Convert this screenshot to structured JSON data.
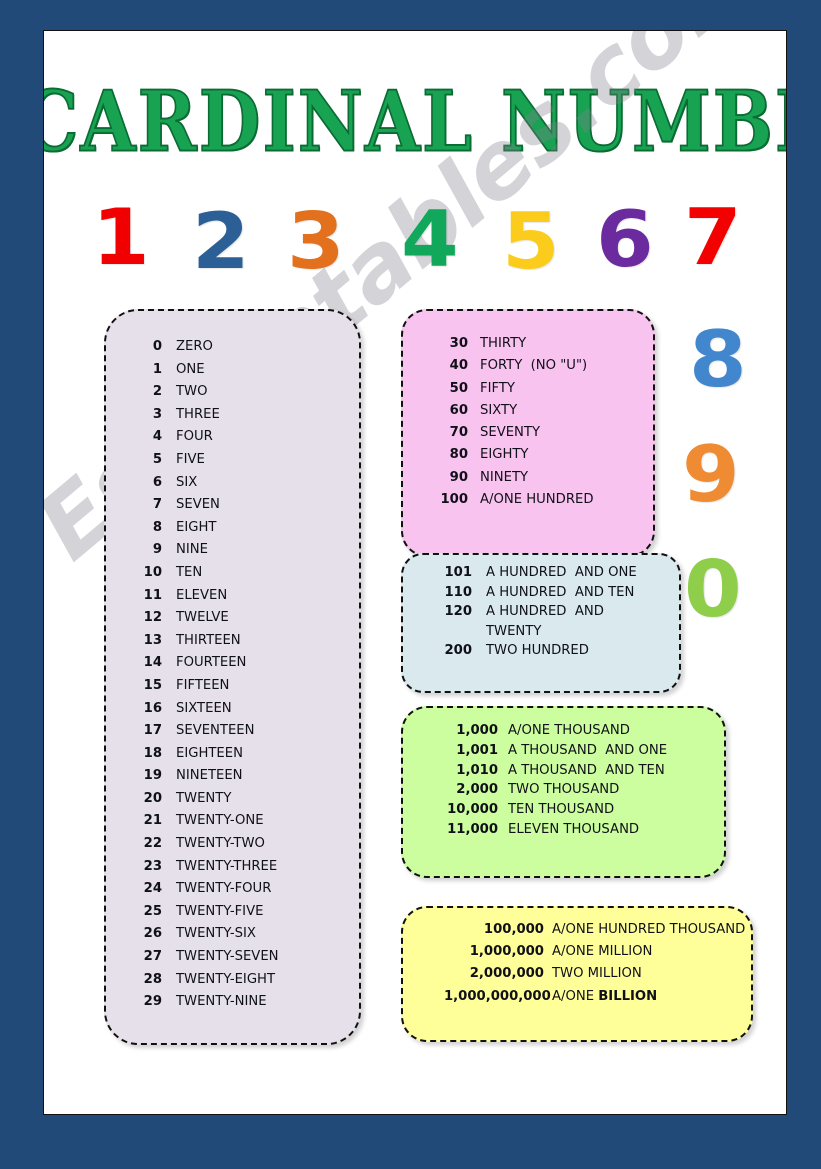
{
  "worksheet": {
    "title": "CARDINAL NUMBERS",
    "watermark": "Eslprintables.com",
    "frame_color": "#214a78",
    "page_color": "#ffffff"
  },
  "digit_banner": {
    "digits": [
      {
        "glyph": "1",
        "color": "#f00000"
      },
      {
        "glyph": "2",
        "color": "#2c5f96"
      },
      {
        "glyph": "3",
        "color": "#e2701d"
      },
      {
        "glyph": "4",
        "color": "#12a85c"
      },
      {
        "glyph": "5",
        "color": "#fbcc1b"
      },
      {
        "glyph": "6",
        "color": "#6b2a9e"
      },
      {
        "glyph": "7",
        "color": "#f30000"
      },
      {
        "glyph": "8",
        "color": "#4287ce"
      },
      {
        "glyph": "9",
        "color": "#ef8b32"
      },
      {
        "glyph": "0",
        "color": "#8ece4a"
      }
    ]
  },
  "panels": {
    "ones_and_teens": {
      "fill": "#e5e0ea",
      "rows": [
        {
          "num": "0",
          "word": "ZERO"
        },
        {
          "num": "1",
          "word": "ONE"
        },
        {
          "num": "2",
          "word": "TWO"
        },
        {
          "num": "3",
          "word": "THREE"
        },
        {
          "num": "4",
          "word": "FOUR"
        },
        {
          "num": "5",
          "word": "FIVE"
        },
        {
          "num": "6",
          "word": "SIX"
        },
        {
          "num": "7",
          "word": "SEVEN"
        },
        {
          "num": "8",
          "word": "EIGHT"
        },
        {
          "num": "9",
          "word": "NINE"
        },
        {
          "num": "10",
          "word": "TEN"
        },
        {
          "num": "11",
          "word": "ELEVEN"
        },
        {
          "num": "12",
          "word": "TWELVE"
        },
        {
          "num": "13",
          "word": "THIRTEEN"
        },
        {
          "num": "14",
          "word": "FOURTEEN"
        },
        {
          "num": "15",
          "word": "FIFTEEN"
        },
        {
          "num": "16",
          "word": "SIXTEEN"
        },
        {
          "num": "17",
          "word": "SEVENTEEN"
        },
        {
          "num": "18",
          "word": "EIGHTEEN"
        },
        {
          "num": "19",
          "word": "NINETEEN"
        },
        {
          "num": "20",
          "word": "TWENTY"
        },
        {
          "num": "21",
          "word": "TWENTY-ONE"
        },
        {
          "num": "22",
          "word": "TWENTY-TWO"
        },
        {
          "num": "23",
          "word": "TWENTY-THREE"
        },
        {
          "num": "24",
          "word": "TWENTY-FOUR"
        },
        {
          "num": "25",
          "word": "TWENTY-FIVE"
        },
        {
          "num": "26",
          "word": "TWENTY-SIX"
        },
        {
          "num": "27",
          "word": "TWENTY-SEVEN"
        },
        {
          "num": "28",
          "word": "TWENTY-EIGHT"
        },
        {
          "num": "29",
          "word": "TWENTY-NINE"
        }
      ]
    },
    "tens": {
      "fill": "#f9c3f0",
      "rows": [
        {
          "num": "30",
          "word": "THIRTY"
        },
        {
          "num": "40",
          "word": "FORTY  (NO \"U\")"
        },
        {
          "num": "50",
          "word": "FIFTY"
        },
        {
          "num": "60",
          "word": "SIXTY"
        },
        {
          "num": "70",
          "word": "SEVENTY"
        },
        {
          "num": "80",
          "word": "EIGHTY"
        },
        {
          "num": "90",
          "word": "NINETY"
        },
        {
          "num": "100",
          "word": "A/ONE HUNDRED"
        }
      ]
    },
    "hundreds": {
      "fill": "#d9e9ee",
      "rows": [
        {
          "num": "101",
          "word": "A HUNDRED  AND ONE"
        },
        {
          "num": "110",
          "word": "A HUNDRED  AND TEN"
        },
        {
          "num": "120",
          "word": "A HUNDRED  AND",
          "continuation": "TWENTY"
        },
        {
          "num": "200",
          "word": "TWO HUNDRED"
        }
      ]
    },
    "thousands": {
      "fill": "#ccfd9e",
      "rows": [
        {
          "num": "1,000",
          "word": "A/ONE THOUSAND"
        },
        {
          "num": "1,001",
          "word": "A THOUSAND  AND ONE"
        },
        {
          "num": "1,010",
          "word": "A THOUSAND  AND TEN"
        },
        {
          "num": "2,000",
          "word": "TWO THOUSAND"
        },
        {
          "num": "10,000",
          "word": "TEN THOUSAND"
        },
        {
          "num": "11,000",
          "word": "ELEVEN THOUSAND"
        }
      ]
    },
    "millions": {
      "fill": "#ffff99",
      "rows": [
        {
          "num": "100,000",
          "word": "A/ONE HUNDRED THOUSAND"
        },
        {
          "num": "1,000,000",
          "word": "A/ONE MILLION"
        },
        {
          "num": "2,000,000",
          "word": "TWO MILLION"
        },
        {
          "num": "1,000,000,000",
          "word_html": "A/ONE <b>BILLION</b>"
        }
      ]
    }
  }
}
